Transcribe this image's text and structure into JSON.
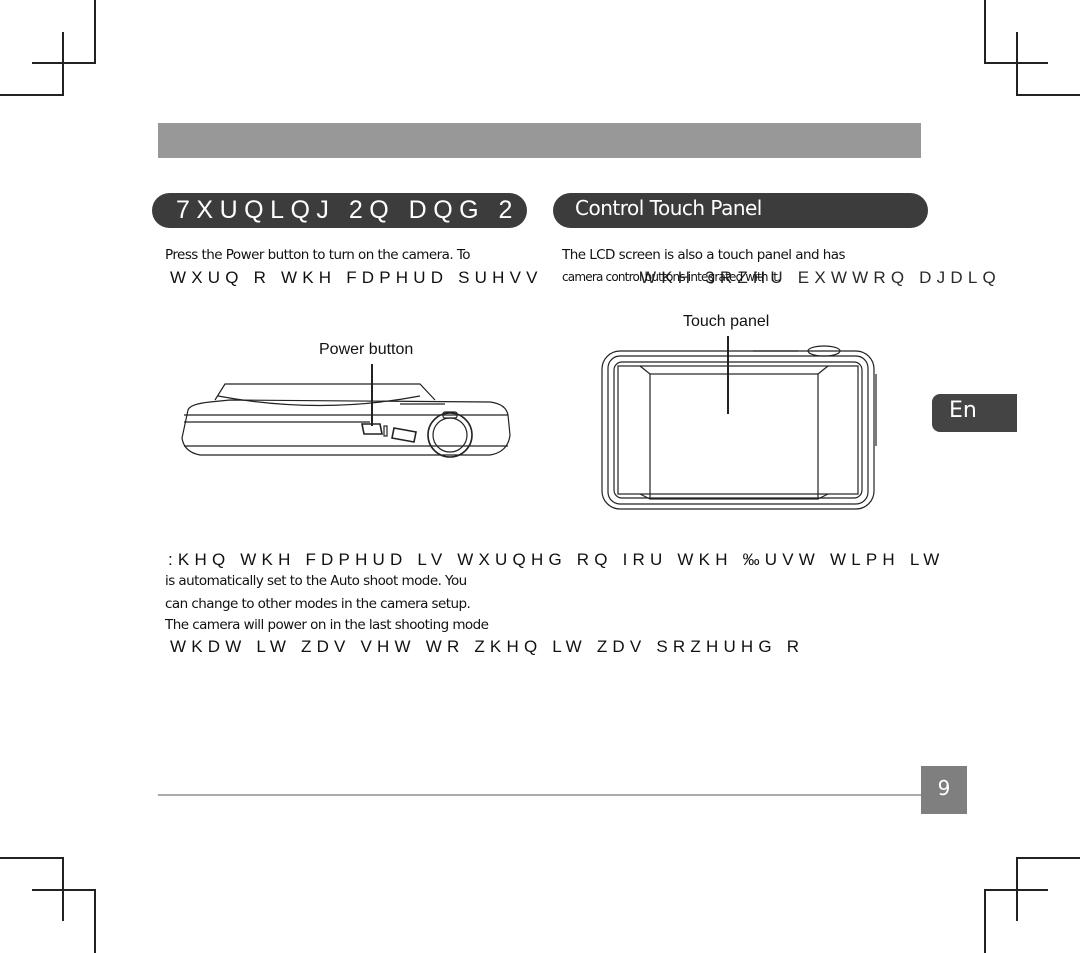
{
  "header": {
    "bar_color": "#989898"
  },
  "sections": {
    "left": {
      "title": "7XUQLQJ 2Q DQG 2",
      "lines": [
        "Press the Power button to turn on the camera. To",
        "WXUQ R   WKH FDPHUD   SUHVV"
      ]
    },
    "right": {
      "title": "Control Touch Panel",
      "lines": [
        "The LCD screen is also a touch panel and has",
        "camera control buttons integrated with it.",
        "WKH 3RZHU EXWWRQ DJDLQ"
      ]
    }
  },
  "figures": {
    "power_button_label": "Power button",
    "touch_panel_label": "Touch panel"
  },
  "notes": {
    "lines": [
      ":KHQ WKH FDPHUD LV WXUQHG RQ IRU WKH ‰UVW WLPH  LW",
      "is automatically set to the Auto shoot mode. You",
      "can change to other modes in the camera setup.",
      "The camera will power on in the last shooting mode",
      "WKDW LW ZDV VHW WR ZKHQ LW ZDV SRZHUHG R"
    ]
  },
  "language_tab": "En",
  "page_number": "9"
}
